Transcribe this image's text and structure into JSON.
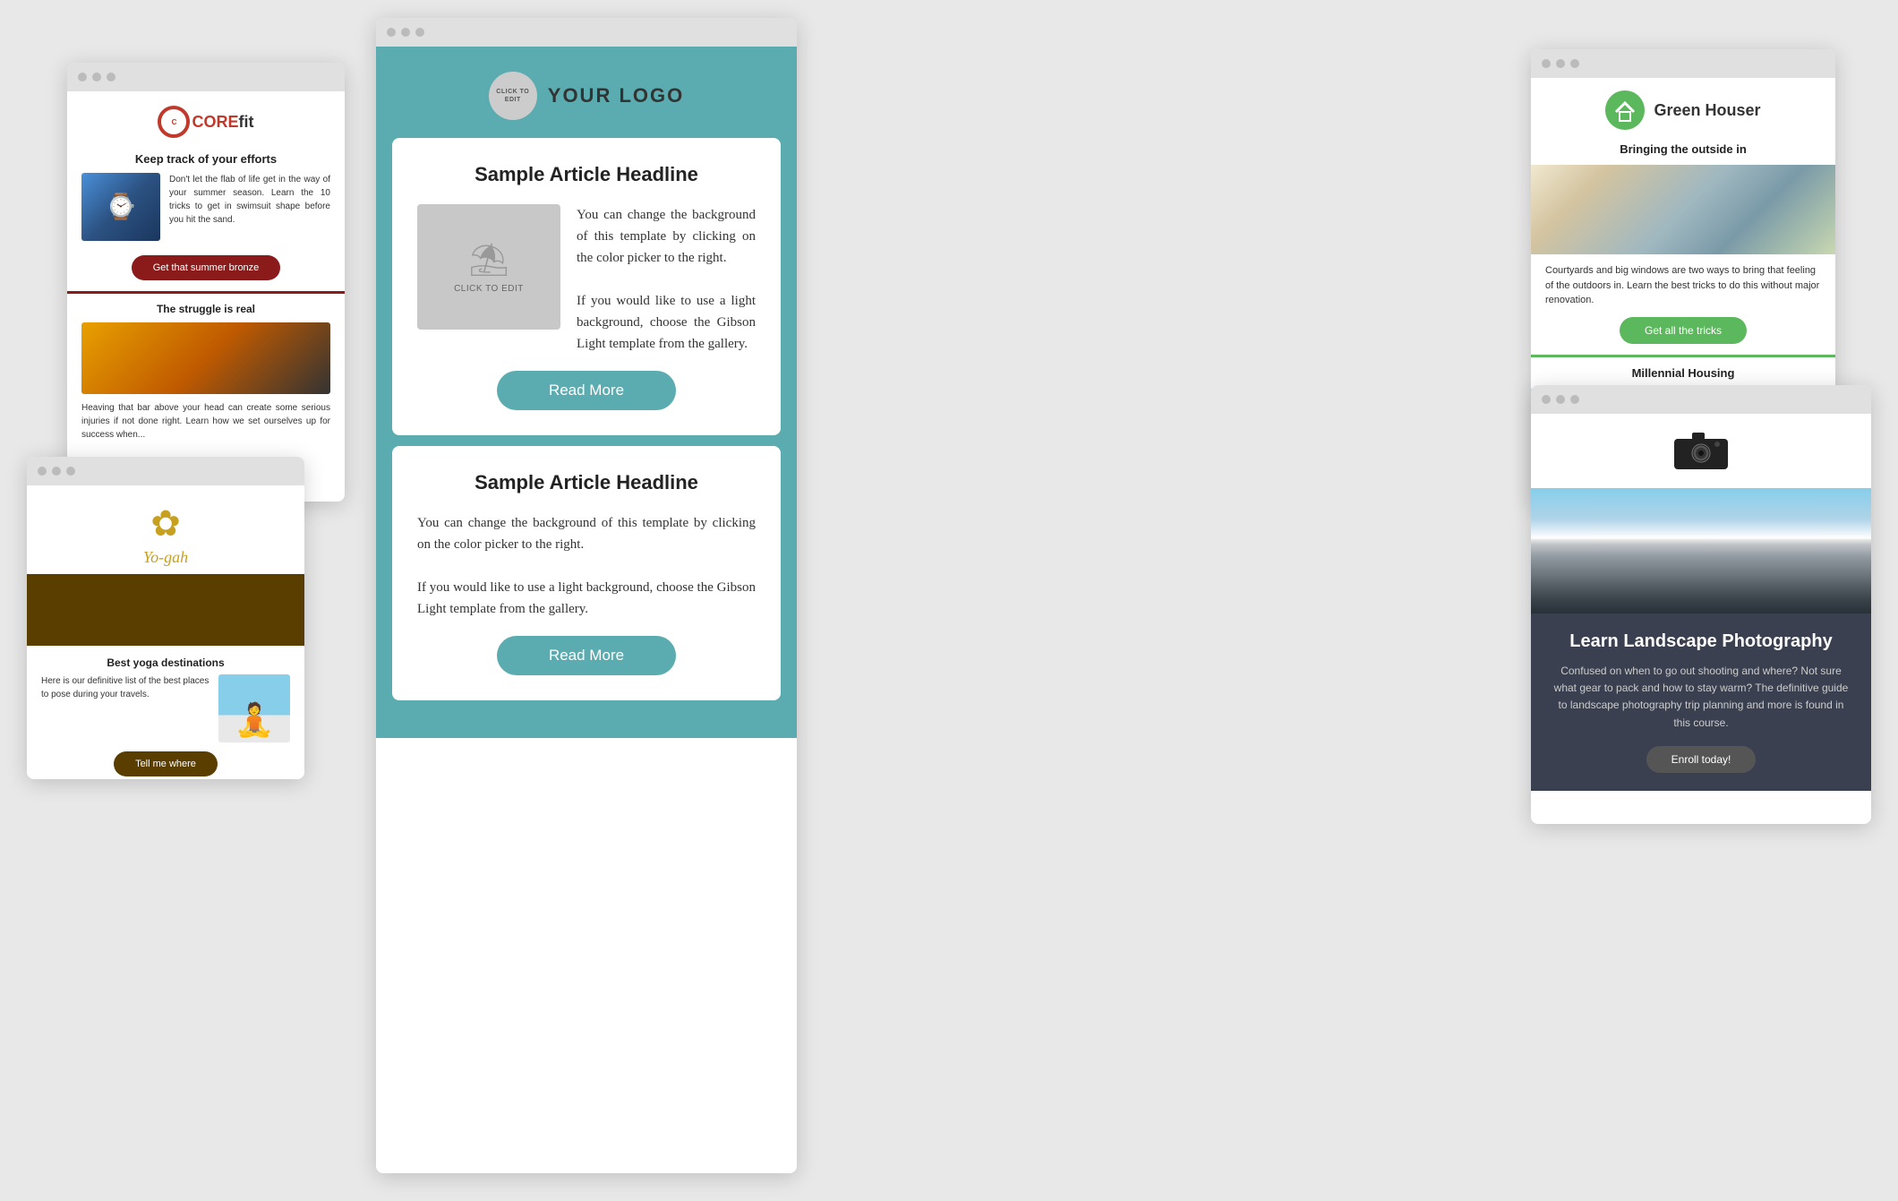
{
  "scene": {
    "background_color": "#e8e8e8"
  },
  "main_window": {
    "logo_circle_text": "CLicK To EDIT",
    "logo_text": "YOUR LOGO",
    "article1": {
      "headline": "Sample Article Headline",
      "body1": "You can change the background of this template by clicking on the color picker to the right.",
      "body2": "If you would like to use a light background, choose the Gibson Light template from the gallery.",
      "image_label": "CLICK TO EDIT",
      "read_more": "Read More"
    },
    "article2": {
      "headline": "Sample Article Headline",
      "body1": "You can change the background of this template by clicking on the color picker to the right.",
      "body2": "If you would like to use a light background, choose the Gibson Light template from the gallery.",
      "read_more": "Read More"
    }
  },
  "corefit_window": {
    "logo_inner": "CORE",
    "logo_text_pre": "CORE",
    "logo_text_brand": "fit",
    "headline1": "Keep track of your efforts",
    "article1_text": "Don't let the flab of life get in the way of your summer season. Learn the 10 tricks to get in swimsuit shape before you hit the sand.",
    "btn1": "Get that summer bronze",
    "headline2": "The struggle is real",
    "article2_text": "Heaving that bar above your head can create some serious injuries if not done right. Learn how we set ourselves up for success when..."
  },
  "yogah_window": {
    "logo_text": "Yo-gah",
    "headline": "Best yoga destinations",
    "article_text": "Here is our definitive list of the best places to pose during your travels.",
    "btn": "Tell me where"
  },
  "greenhouser_window": {
    "logo_text": "Green Houser",
    "headline": "Bringing the outside in",
    "article_text": "Courtyards and big windows are two ways to bring that feeling of the outdoors in. Learn the best tricks to do this without major renovation.",
    "btn": "Get all the tricks",
    "headline2": "Millennial Housing"
  },
  "photo_window": {
    "headline": "Learn Landscape Photography",
    "body": "Confused on when to go out shooting and where? Not sure what gear to pack and how to stay warm? The definitive guide to landscape photography trip planning and more is found in this course.",
    "btn": "Enroll today!"
  }
}
